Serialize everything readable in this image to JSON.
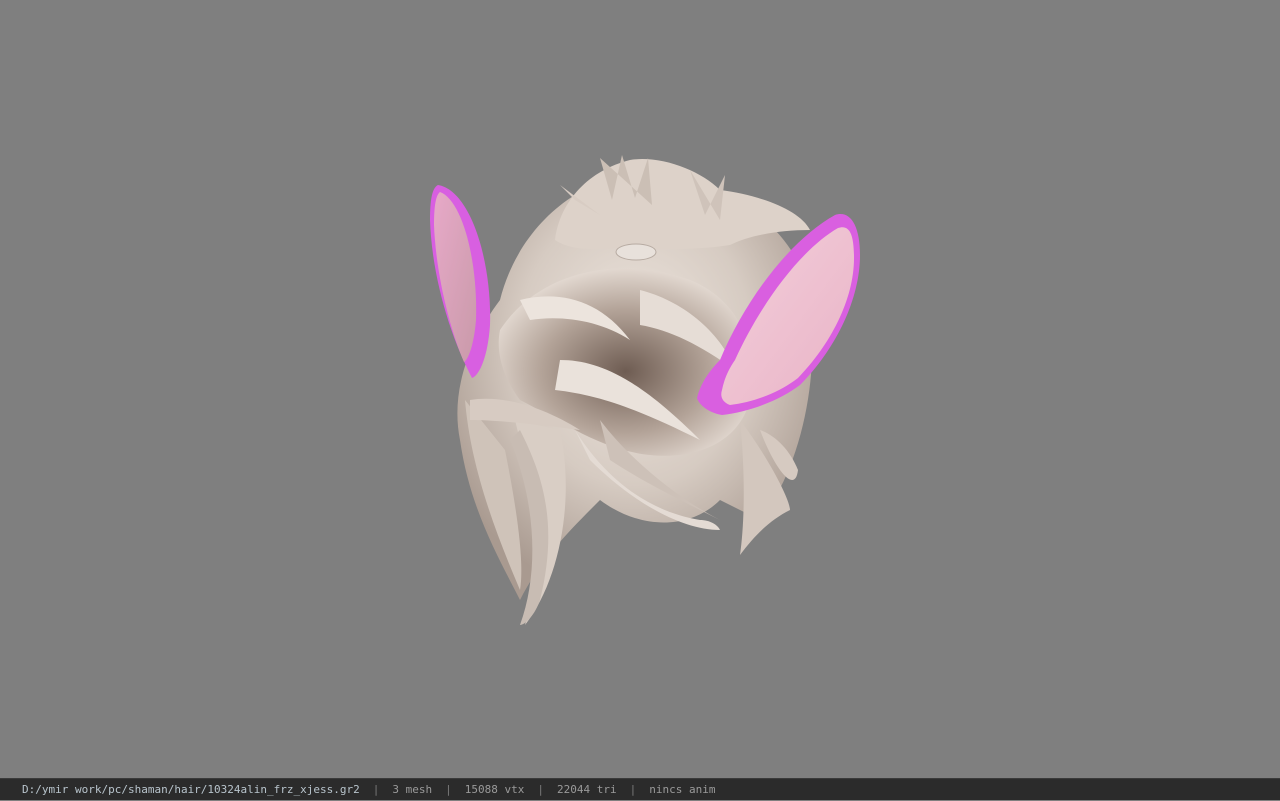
{
  "viewer": {
    "background_color": "#7f7f7f",
    "model_colors": {
      "hair_light": "#e6ddd6",
      "hair_mid": "#c4b6ab",
      "hair_dark": "#7d6a60",
      "ear_inner": "#f0c2d2",
      "ear_rim": "#d95fe0"
    }
  },
  "status": {
    "file_path": "D:/ymir work/pc/shaman/hair/10324alin_frz_xjess.gr2",
    "separator": "|",
    "mesh_count": "3 mesh",
    "vertex_count": "15088 vtx",
    "triangle_count": "22044 tri",
    "anim_info": "nincs anim"
  }
}
